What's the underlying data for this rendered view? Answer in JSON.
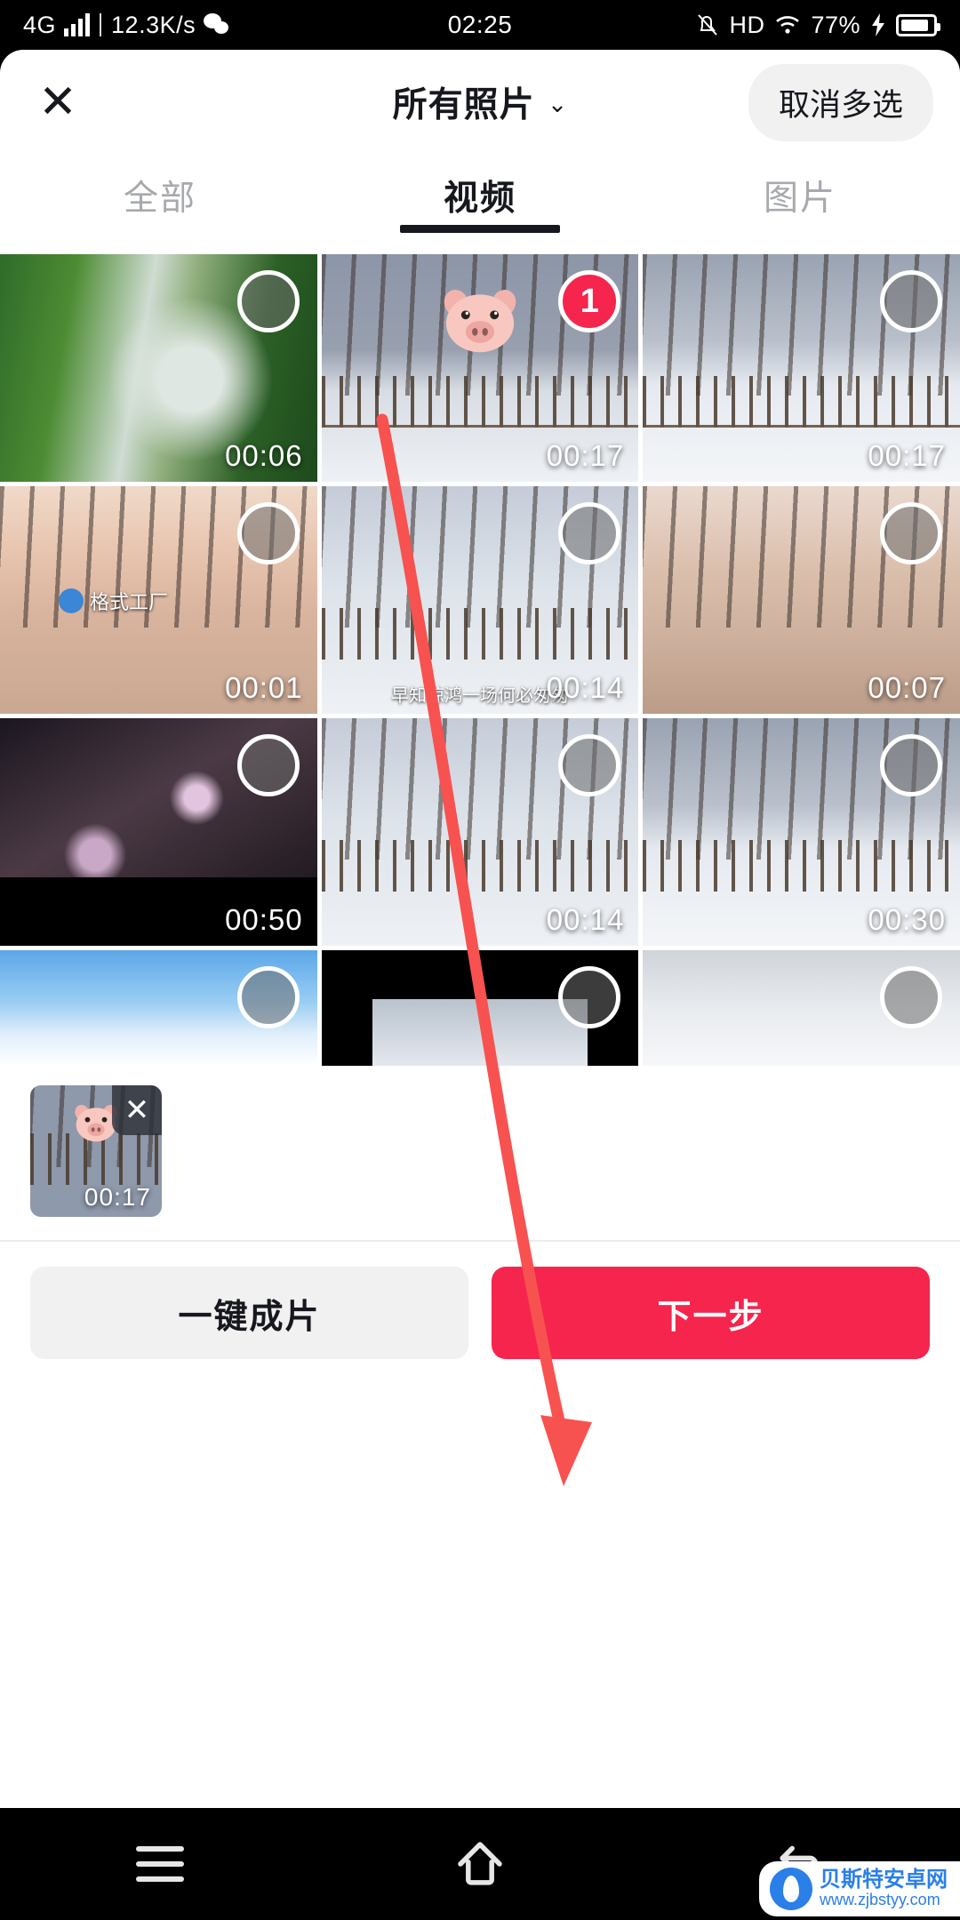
{
  "status_bar": {
    "network": "4G",
    "speed": "12.3K/s",
    "time": "02:25",
    "hd": "HD",
    "battery": "77%",
    "icons": [
      "signal-bars-icon",
      "wechat-icon",
      "mute-icon",
      "wifi-icon",
      "charging-bolt-icon",
      "battery-icon"
    ]
  },
  "header": {
    "close_icon": "close-icon",
    "title": "所有照片",
    "chevron": "⌄",
    "multiselect_cancel": "取消多选"
  },
  "tabs": [
    {
      "label": "全部",
      "active": false
    },
    {
      "label": "视频",
      "active": true
    },
    {
      "label": "图片",
      "active": false
    }
  ],
  "grid": {
    "items": [
      {
        "duration": "00:06",
        "selected": false,
        "badge": "",
        "art": "a-waterfall",
        "overlay": "waterfall"
      },
      {
        "duration": "00:17",
        "selected": true,
        "badge": "1",
        "art": "a-snowrail",
        "overlay": "snowrail-pig"
      },
      {
        "duration": "00:17",
        "selected": false,
        "badge": "",
        "art": "a-snowrail2",
        "overlay": "snowrail"
      },
      {
        "duration": "00:01",
        "selected": false,
        "badge": "",
        "art": "a-sunset",
        "overlay": "sunset-logo"
      },
      {
        "duration": "00:14",
        "selected": false,
        "badge": "",
        "art": "a-snowtree",
        "overlay": "snowrail-caption"
      },
      {
        "duration": "00:07",
        "selected": false,
        "badge": "",
        "art": "a-sunset2",
        "overlay": "sunset"
      },
      {
        "duration": "00:50",
        "selected": false,
        "badge": "",
        "art": "a-blossom",
        "overlay": "letterbox"
      },
      {
        "duration": "00:14",
        "selected": false,
        "badge": "",
        "art": "a-snowtree",
        "overlay": "snowrail"
      },
      {
        "duration": "00:30",
        "selected": false,
        "badge": "",
        "art": "a-snowrail2",
        "overlay": "snowrail"
      },
      {
        "duration": "",
        "selected": false,
        "badge": "",
        "art": "a-birds",
        "overlay": "birds"
      },
      {
        "duration": "",
        "selected": false,
        "badge": "",
        "art": "a-dark",
        "overlay": "letterbox-partial"
      },
      {
        "duration": "",
        "selected": false,
        "badge": "",
        "art": "a-fog",
        "overlay": "fog"
      }
    ],
    "watermark_text": "格式工厂",
    "caption_text": "早知惊鸿一场何必匆匆"
  },
  "tray": {
    "thumb_duration": "00:17",
    "remove_icon": "close-icon"
  },
  "bottom_actions": {
    "secondary_label": "一键成片",
    "primary_label": "下一步",
    "primary_color": "#f5254d",
    "secondary_color": "#f1f1f2"
  },
  "nav_bar": {
    "items": [
      "menu-icon",
      "home-icon",
      "back-icon"
    ]
  },
  "site_watermark": {
    "name": "贝斯特安卓网",
    "url": "www.zjbstyy.com"
  },
  "annotation": {
    "type": "red-arrow",
    "color": "#f7524f",
    "from": "selected video thumbnail",
    "to": "下一步 button"
  }
}
